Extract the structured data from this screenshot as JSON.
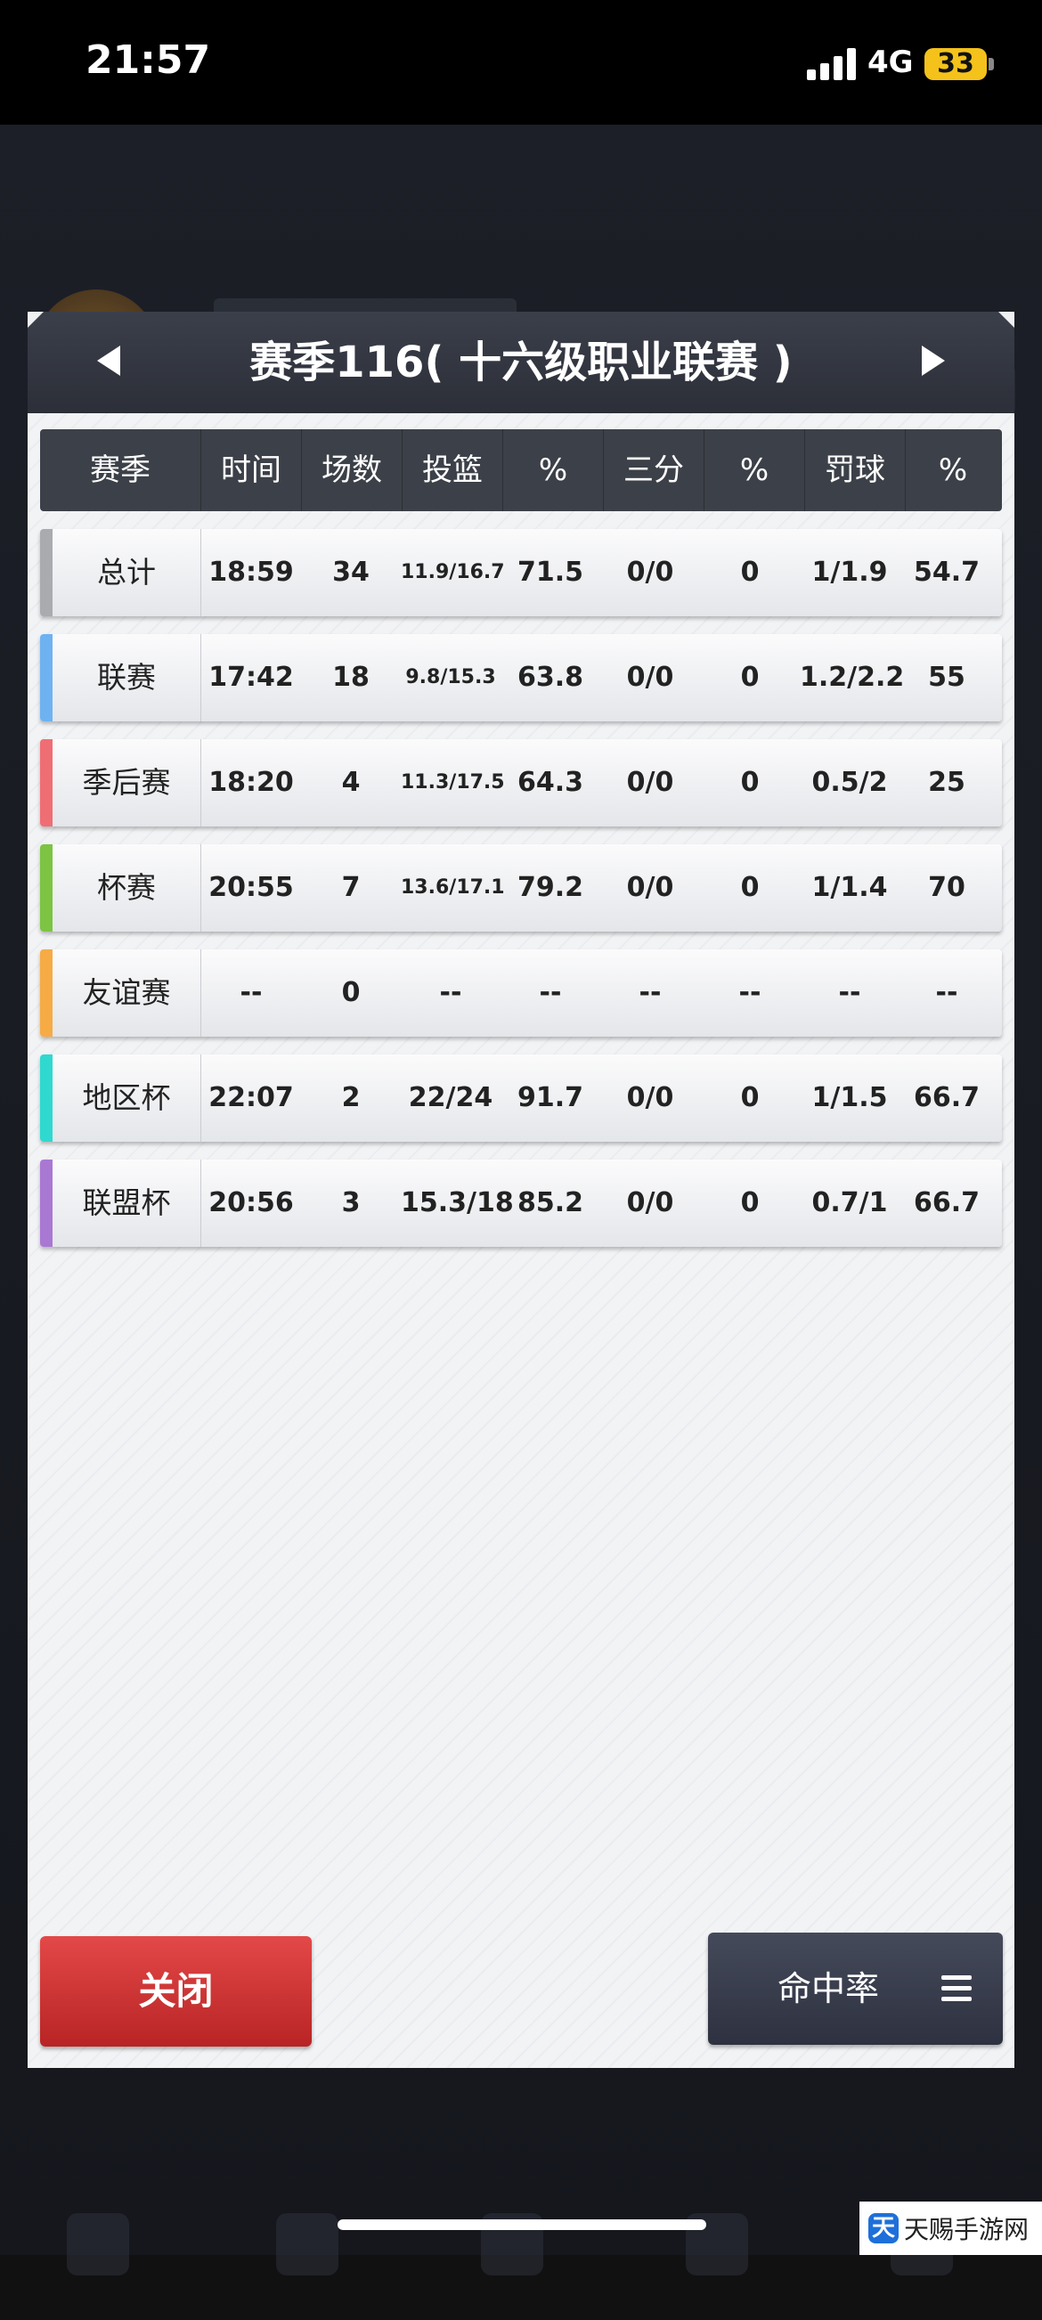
{
  "status_bar": {
    "time": "21:57",
    "network": "4G",
    "battery": "33"
  },
  "dialog": {
    "title": "赛季116( 十六级职业联赛 )",
    "columns": [
      "赛季",
      "时间",
      "场数",
      "投篮",
      "%",
      "三分",
      "%",
      "罚球",
      "%"
    ],
    "rows": [
      {
        "label": "总计",
        "color": "#a9abaf",
        "values": [
          "18:59",
          "34",
          "11.9/16.7",
          "71.5",
          "0/0",
          "0",
          "1/1.9",
          "54.7"
        ]
      },
      {
        "label": "联赛",
        "color": "#6fb2f2",
        "values": [
          "17:42",
          "18",
          "9.8/15.3",
          "63.8",
          "0/0",
          "0",
          "1.2/2.2",
          "55"
        ]
      },
      {
        "label": "季后赛",
        "color": "#ef6e74",
        "values": [
          "18:20",
          "4",
          "11.3/17.5",
          "64.3",
          "0/0",
          "0",
          "0.5/2",
          "25"
        ]
      },
      {
        "label": "杯赛",
        "color": "#7cc442",
        "values": [
          "20:55",
          "7",
          "13.6/17.1",
          "79.2",
          "0/0",
          "0",
          "1/1.4",
          "70"
        ]
      },
      {
        "label": "友谊赛",
        "color": "#f6ab45",
        "values": [
          "--",
          "0",
          "--",
          "--",
          "--",
          "--",
          "--",
          "--"
        ]
      },
      {
        "label": "地区杯",
        "color": "#2fd9cf",
        "values": [
          "22:07",
          "2",
          "22/24",
          "91.7",
          "0/0",
          "0",
          "1/1.5",
          "66.7"
        ]
      },
      {
        "label": "联盟杯",
        "color": "#a978d3",
        "values": [
          "20:56",
          "3",
          "15.3/18",
          "85.2",
          "0/0",
          "0",
          "0.7/1",
          "66.7"
        ]
      }
    ],
    "close_label": "关闭",
    "rate_label": "命中率"
  },
  "watermark": {
    "text": "天赐手游网",
    "logo": "天"
  },
  "icons": {
    "menu": "menu-icon",
    "prev": "arrow-left-icon",
    "next": "arrow-right-icon"
  }
}
